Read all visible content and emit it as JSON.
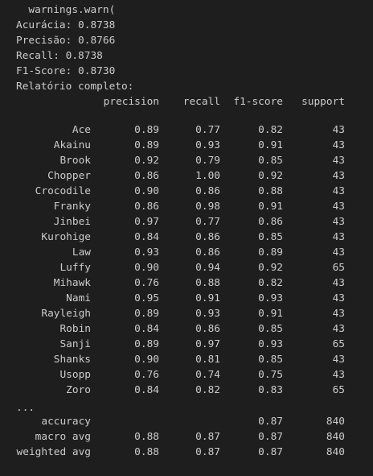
{
  "output": {
    "warn_line": "  warnings.warn(",
    "metrics": [
      "Acurácia: 0.8738",
      "Precisão: 0.8766",
      "Recall: 0.8738",
      "F1-Score: 0.8730"
    ],
    "report_title": "Relatório completo:"
  },
  "report": {
    "headers": {
      "precision": "precision",
      "recall": "recall",
      "f1": "f1-score",
      "support": "support"
    },
    "rows": [
      {
        "label": "Ace",
        "precision": "0.89",
        "recall": "0.77",
        "f1": "0.82",
        "support": "43"
      },
      {
        "label": "Akainu",
        "precision": "0.89",
        "recall": "0.93",
        "f1": "0.91",
        "support": "43"
      },
      {
        "label": "Brook",
        "precision": "0.92",
        "recall": "0.79",
        "f1": "0.85",
        "support": "43"
      },
      {
        "label": "Chopper",
        "precision": "0.86",
        "recall": "1.00",
        "f1": "0.92",
        "support": "43"
      },
      {
        "label": "Crocodile",
        "precision": "0.90",
        "recall": "0.86",
        "f1": "0.88",
        "support": "43"
      },
      {
        "label": "Franky",
        "precision": "0.86",
        "recall": "0.98",
        "f1": "0.91",
        "support": "43"
      },
      {
        "label": "Jinbei",
        "precision": "0.97",
        "recall": "0.77",
        "f1": "0.86",
        "support": "43"
      },
      {
        "label": "Kurohige",
        "precision": "0.84",
        "recall": "0.86",
        "f1": "0.85",
        "support": "43"
      },
      {
        "label": "Law",
        "precision": "0.93",
        "recall": "0.86",
        "f1": "0.89",
        "support": "43"
      },
      {
        "label": "Luffy",
        "precision": "0.90",
        "recall": "0.94",
        "f1": "0.92",
        "support": "65"
      },
      {
        "label": "Mihawk",
        "precision": "0.76",
        "recall": "0.88",
        "f1": "0.82",
        "support": "43"
      },
      {
        "label": "Nami",
        "precision": "0.95",
        "recall": "0.91",
        "f1": "0.93",
        "support": "43"
      },
      {
        "label": "Rayleigh",
        "precision": "0.89",
        "recall": "0.93",
        "f1": "0.91",
        "support": "43"
      },
      {
        "label": "Robin",
        "precision": "0.84",
        "recall": "0.86",
        "f1": "0.85",
        "support": "43"
      },
      {
        "label": "Sanji",
        "precision": "0.89",
        "recall": "0.97",
        "f1": "0.93",
        "support": "65"
      },
      {
        "label": "Shanks",
        "precision": "0.90",
        "recall": "0.81",
        "f1": "0.85",
        "support": "43"
      },
      {
        "label": "Usopp",
        "precision": "0.76",
        "recall": "0.74",
        "f1": "0.75",
        "support": "43"
      },
      {
        "label": "Zoro",
        "precision": "0.84",
        "recall": "0.82",
        "f1": "0.83",
        "support": "65"
      }
    ],
    "ellipsis": "...",
    "summary": [
      {
        "label": "accuracy",
        "precision": "",
        "recall": "",
        "f1": "0.87",
        "support": "840"
      },
      {
        "label": "macro avg",
        "precision": "0.88",
        "recall": "0.87",
        "f1": "0.87",
        "support": "840"
      },
      {
        "label": "weighted avg",
        "precision": "0.88",
        "recall": "0.87",
        "f1": "0.87",
        "support": "840"
      }
    ]
  },
  "theme": {
    "background": "#1e1e1e",
    "text": "#cccccc"
  }
}
